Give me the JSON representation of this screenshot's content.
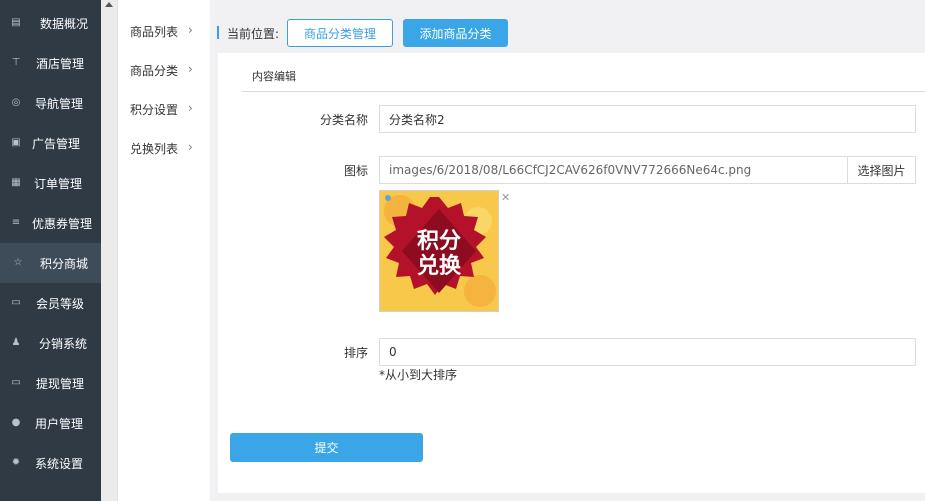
{
  "sidebar": {
    "items": [
      {
        "label": "数据概况",
        "icon": "newspaper-icon",
        "glyph": "▤"
      },
      {
        "label": "酒店管理",
        "icon": "cart-icon",
        "glyph": "⊤"
      },
      {
        "label": "导航管理",
        "icon": "compass-icon",
        "glyph": "◎"
      },
      {
        "label": "广告管理",
        "icon": "gift-icon",
        "glyph": "▣"
      },
      {
        "label": "订单管理",
        "icon": "list-box-icon",
        "glyph": "▦"
      },
      {
        "label": "优惠券管理",
        "icon": "menu-lines-icon",
        "glyph": "≡"
      },
      {
        "label": "积分商城",
        "icon": "star-icon",
        "glyph": "☆"
      },
      {
        "label": "会员等级",
        "icon": "money-icon",
        "glyph": "▭"
      },
      {
        "label": "分销系统",
        "icon": "users-icon",
        "glyph": "♟"
      },
      {
        "label": "提现管理",
        "icon": "money-icon",
        "glyph": "▭"
      },
      {
        "label": "用户管理",
        "icon": "user-icon",
        "glyph": "●"
      },
      {
        "label": "系统设置",
        "icon": "gear-icon",
        "glyph": "✹"
      }
    ],
    "active_index": 6
  },
  "submenu": {
    "items": [
      {
        "label": "商品列表"
      },
      {
        "label": "商品分类"
      },
      {
        "label": "积分设置"
      },
      {
        "label": "兑换列表"
      }
    ]
  },
  "breadcrumb": {
    "label": "当前位置:",
    "current_button": "商品分类管理",
    "add_button": "添加商品分类"
  },
  "form": {
    "section_title": "内容编辑",
    "name_label": "分类名称",
    "name_value": "分类名称2",
    "icon_label": "图标",
    "icon_path": "images/6/2018/08/L66CfCJ2CAV626f0VNV772666Ne64c.png",
    "pick_button": "选择图片",
    "image_text_top": "积分",
    "image_text_bottom": "兑换",
    "sort_label": "排序",
    "sort_value": "0",
    "sort_hint": "*从小到大排序",
    "submit_label": "提交"
  },
  "colors": {
    "sidebar_bg": "#2f3a45",
    "accent": "#3aa6e8",
    "badge_red": "#b3122a"
  }
}
